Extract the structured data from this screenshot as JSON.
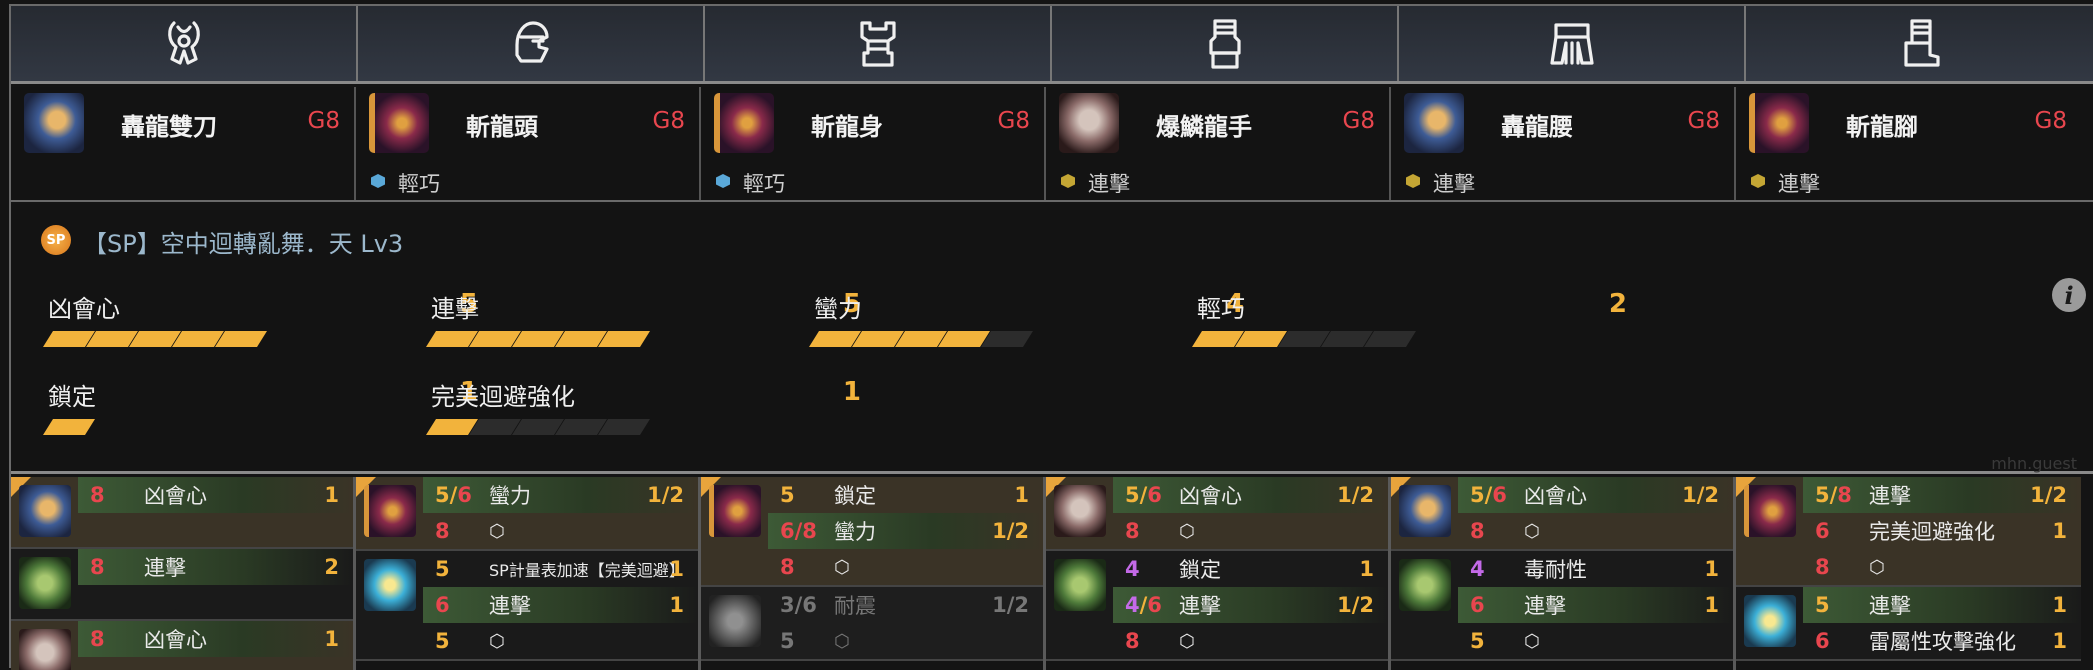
{
  "slots": [
    {
      "icon": "weapon-slot-icon"
    },
    {
      "icon": "head-slot-icon"
    },
    {
      "icon": "chest-slot-icon"
    },
    {
      "icon": "arms-slot-icon"
    },
    {
      "icon": "waist-slot-icon"
    },
    {
      "icon": "legs-slot-icon"
    }
  ],
  "equipment": [
    {
      "name": "轟龍雙刀",
      "rank": "G8",
      "skill": "",
      "thumb": "blue",
      "dot": ""
    },
    {
      "name": "斬龍頭",
      "rank": "G8",
      "skill": "輕巧",
      "thumb": "red",
      "dot": "blue"
    },
    {
      "name": "斬龍身",
      "rank": "G8",
      "skill": "輕巧",
      "thumb": "red",
      "dot": "blue"
    },
    {
      "name": "爆鱗龍手",
      "rank": "G8",
      "skill": "連擊",
      "thumb": "grey",
      "dot": "gold"
    },
    {
      "name": "轟龍腰",
      "rank": "G8",
      "skill": "連擊",
      "thumb": "blue",
      "dot": "gold"
    },
    {
      "name": "斬龍腳",
      "rank": "G8",
      "skill": "連擊",
      "thumb": "red",
      "dot": "gold"
    }
  ],
  "summary": {
    "sp_badge": "SP",
    "sp_skill": "【SP】空中迴轉亂舞．天 Lv3",
    "info_icon": "i",
    "watermark": "mhn.guest",
    "skills": [
      {
        "name": "凶會心",
        "level": "5",
        "filled": 5,
        "max": 5
      },
      {
        "name": "連擊",
        "level": "5",
        "filled": 5,
        "max": 5
      },
      {
        "name": "蠻力",
        "level": "4",
        "filled": 4,
        "max": 5
      },
      {
        "name": "輕巧",
        "level": "2",
        "filled": 2,
        "max": 5
      },
      {
        "name": "鎖定",
        "level": "1",
        "filled": 1,
        "max": 1
      },
      {
        "name": "完美迴避強化",
        "level": "1",
        "filled": 1,
        "max": 5
      }
    ]
  },
  "decorations": [
    [
      {
        "thumb": "blue",
        "bg": "g1",
        "corner": true,
        "rows": [
          {
            "lvl": "8",
            "lvl_color": "red",
            "name": "凶會心",
            "max": "1",
            "hl": true
          }
        ]
      },
      {
        "thumb": "green",
        "bg": "g2",
        "rows": [
          {
            "lvl": "8",
            "lvl_color": "red",
            "name": "連擊",
            "max": "2",
            "hl": true
          }
        ]
      },
      {
        "thumb": "grey",
        "bg": "g1",
        "rows": [
          {
            "lvl": "8",
            "lvl_color": "red",
            "name": "凶會心",
            "max": "1",
            "hl": true
          }
        ]
      }
    ],
    [
      {
        "thumb": "red",
        "bg": "g1",
        "corner": true,
        "rows": [
          {
            "lvl": "5/6",
            "lvl_color": "split",
            "name": "蠻力",
            "max": "1/2",
            "hl": true
          },
          {
            "lvl": "8",
            "lvl_color": "red",
            "name": "⬡",
            "max": "",
            "hl": false
          }
        ]
      },
      {
        "thumb": "ice",
        "bg": "g2",
        "rows": [
          {
            "lvl": "5",
            "lvl_color": "gold",
            "name": "SP計量表加速【完美迴避】",
            "max": "1",
            "hl": false,
            "small": true
          },
          {
            "lvl": "6",
            "lvl_color": "red",
            "name": "連擊",
            "max": "1",
            "hl": true
          },
          {
            "lvl": "5",
            "lvl_color": "gold",
            "name": "⬡",
            "max": "",
            "hl": false
          }
        ]
      }
    ],
    [
      {
        "thumb": "red",
        "bg": "g1",
        "corner": true,
        "rows": [
          {
            "lvl": "5",
            "lvl_color": "gold",
            "name": "鎖定",
            "max": "1",
            "hl": false
          },
          {
            "lvl": "6/8",
            "lvl_color": "red",
            "name": "蠻力",
            "max": "1/2",
            "hl": true
          },
          {
            "lvl": "8",
            "lvl_color": "red",
            "name": "⬡",
            "max": "",
            "hl": false
          }
        ]
      },
      {
        "thumb": "stone",
        "bg": "gray",
        "dim": true,
        "rows": [
          {
            "lvl": "3/6",
            "lvl_color": "dim",
            "name": "耐震",
            "max": "1/2",
            "hl": false,
            "dim": true
          },
          {
            "lvl": "5",
            "lvl_color": "dim",
            "name": "⬡",
            "max": "",
            "hl": false,
            "dim": true
          }
        ]
      }
    ],
    [
      {
        "thumb": "grey",
        "bg": "g1",
        "corner": true,
        "rows": [
          {
            "lvl": "5/6",
            "lvl_color": "split",
            "name": "凶會心",
            "max": "1/2",
            "hl": true
          },
          {
            "lvl": "8",
            "lvl_color": "red",
            "name": "⬡",
            "max": "",
            "hl": false
          }
        ]
      },
      {
        "thumb": "green",
        "bg": "g2",
        "rows": [
          {
            "lvl": "4",
            "lvl_color": "purple",
            "name": "鎖定",
            "max": "1",
            "hl": false
          },
          {
            "lvl": "4/6",
            "lvl_color": "purplered",
            "name": "連擊",
            "max": "1/2",
            "hl": true
          },
          {
            "lvl": "8",
            "lvl_color": "red",
            "name": "⬡",
            "max": "",
            "hl": false
          }
        ]
      }
    ],
    [
      {
        "thumb": "blue",
        "bg": "g1",
        "corner": true,
        "rows": [
          {
            "lvl": "5/6",
            "lvl_color": "split",
            "name": "凶會心",
            "max": "1/2",
            "hl": true
          },
          {
            "lvl": "8",
            "lvl_color": "red",
            "name": "⬡",
            "max": "",
            "hl": false
          }
        ]
      },
      {
        "thumb": "green",
        "bg": "g2",
        "rows": [
          {
            "lvl": "4",
            "lvl_color": "purple",
            "name": "毒耐性",
            "max": "1",
            "hl": false
          },
          {
            "lvl": "6",
            "lvl_color": "red",
            "name": "連擊",
            "max": "1",
            "hl": true
          },
          {
            "lvl": "5",
            "lvl_color": "gold",
            "name": "⬡",
            "max": "",
            "hl": false
          }
        ]
      }
    ],
    [
      {
        "thumb": "red",
        "bg": "g1",
        "corner": true,
        "rows": [
          {
            "lvl": "5/8",
            "lvl_color": "split",
            "name": "連擊",
            "max": "1/2",
            "hl": true
          },
          {
            "lvl": "6",
            "lvl_color": "red",
            "name": "完美迴避強化",
            "max": "1",
            "hl": false
          },
          {
            "lvl": "8",
            "lvl_color": "red",
            "name": "⬡",
            "max": "",
            "hl": false
          }
        ]
      },
      {
        "thumb": "ice",
        "bg": "g2",
        "rows": [
          {
            "lvl": "5",
            "lvl_color": "gold",
            "name": "連擊",
            "max": "1",
            "hl": true
          },
          {
            "lvl": "6",
            "lvl_color": "red",
            "name": "雷屬性攻擊強化",
            "max": "1",
            "hl": false
          }
        ]
      }
    ]
  ]
}
